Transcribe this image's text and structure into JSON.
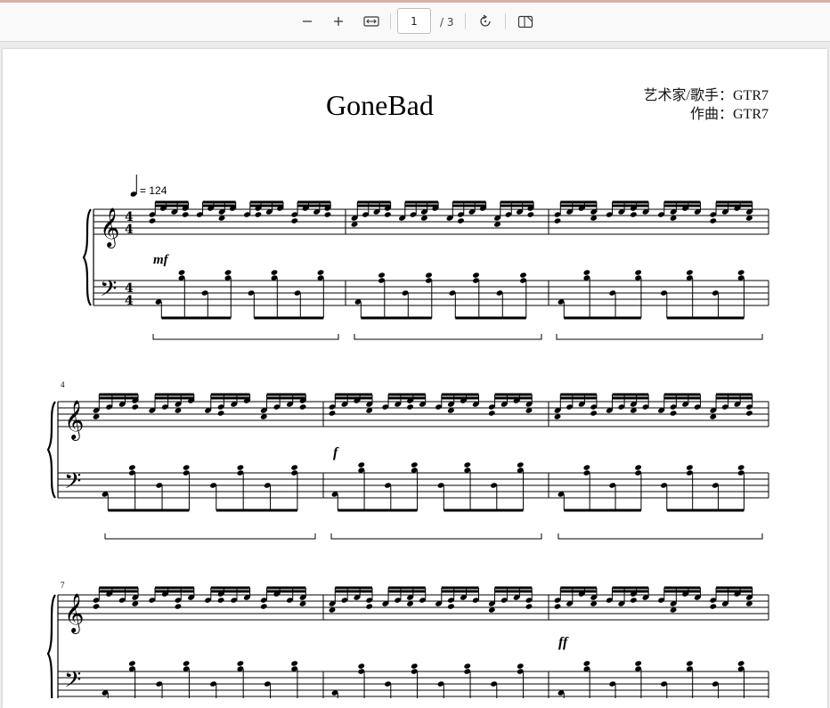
{
  "toolbar": {
    "zoom_out_icon": "minus-icon",
    "zoom_in_icon": "plus-icon",
    "fit_width_icon": "fit-width-icon",
    "page_number": "1",
    "page_total": "/ 3",
    "rotate_icon": "rotate-icon",
    "page_view_icon": "page-view-icon"
  },
  "score": {
    "title": "GoneBad",
    "artist_line": "艺术家/歌手：GTR7",
    "composer_line": "作曲：GTR7",
    "tempo": "= 124",
    "measure_numbers": [
      "4",
      "7"
    ],
    "dynamics": [
      "mf",
      "f",
      "ff"
    ],
    "time_signature": "4/4"
  }
}
